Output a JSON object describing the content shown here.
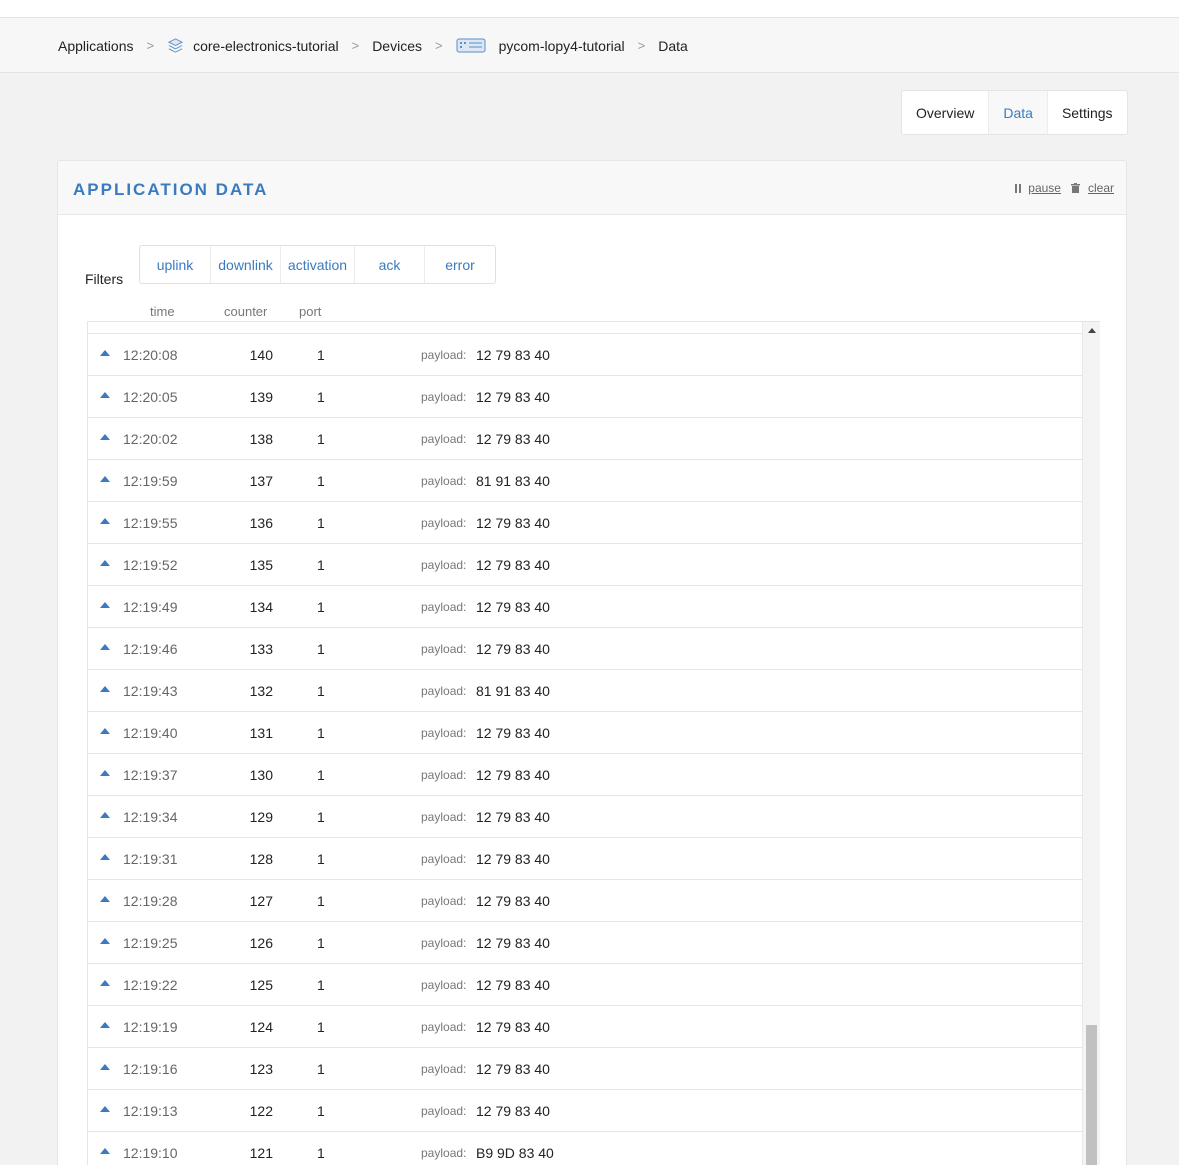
{
  "breadcrumb": {
    "applications": "Applications",
    "application": "core-electronics-tutorial",
    "devices": "Devices",
    "device": "pycom-lopy4-tutorial",
    "current": "Data",
    "separator": ">"
  },
  "tabs": [
    {
      "label": "Overview",
      "active": false
    },
    {
      "label": "Data",
      "active": true
    },
    {
      "label": "Settings",
      "active": false
    }
  ],
  "panel": {
    "title": "APPLICATION DATA",
    "pause_label": "pause",
    "clear_label": "clear"
  },
  "filters": {
    "label": "Filters",
    "items": [
      "uplink",
      "downlink",
      "activation",
      "ack",
      "error"
    ]
  },
  "columns": {
    "time": "time",
    "counter": "counter",
    "port": "port"
  },
  "payload_label": "payload:",
  "rows": [
    {
      "time": "12:20:08",
      "counter": "140",
      "port": "1",
      "payload": "12 79 83 40"
    },
    {
      "time": "12:20:05",
      "counter": "139",
      "port": "1",
      "payload": "12 79 83 40"
    },
    {
      "time": "12:20:02",
      "counter": "138",
      "port": "1",
      "payload": "12 79 83 40"
    },
    {
      "time": "12:19:59",
      "counter": "137",
      "port": "1",
      "payload": "81 91 83 40"
    },
    {
      "time": "12:19:55",
      "counter": "136",
      "port": "1",
      "payload": "12 79 83 40"
    },
    {
      "time": "12:19:52",
      "counter": "135",
      "port": "1",
      "payload": "12 79 83 40"
    },
    {
      "time": "12:19:49",
      "counter": "134",
      "port": "1",
      "payload": "12 79 83 40"
    },
    {
      "time": "12:19:46",
      "counter": "133",
      "port": "1",
      "payload": "12 79 83 40"
    },
    {
      "time": "12:19:43",
      "counter": "132",
      "port": "1",
      "payload": "81 91 83 40"
    },
    {
      "time": "12:19:40",
      "counter": "131",
      "port": "1",
      "payload": "12 79 83 40"
    },
    {
      "time": "12:19:37",
      "counter": "130",
      "port": "1",
      "payload": "12 79 83 40"
    },
    {
      "time": "12:19:34",
      "counter": "129",
      "port": "1",
      "payload": "12 79 83 40"
    },
    {
      "time": "12:19:31",
      "counter": "128",
      "port": "1",
      "payload": "12 79 83 40"
    },
    {
      "time": "12:19:28",
      "counter": "127",
      "port": "1",
      "payload": "12 79 83 40"
    },
    {
      "time": "12:19:25",
      "counter": "126",
      "port": "1",
      "payload": "12 79 83 40"
    },
    {
      "time": "12:19:22",
      "counter": "125",
      "port": "1",
      "payload": "12 79 83 40"
    },
    {
      "time": "12:19:19",
      "counter": "124",
      "port": "1",
      "payload": "12 79 83 40"
    },
    {
      "time": "12:19:16",
      "counter": "123",
      "port": "1",
      "payload": "12 79 83 40"
    },
    {
      "time": "12:19:13",
      "counter": "122",
      "port": "1",
      "payload": "12 79 83 40"
    },
    {
      "time": "12:19:10",
      "counter": "121",
      "port": "1",
      "payload": "B9 9D 83 40"
    }
  ],
  "colors": {
    "accent": "#3a7bbf",
    "background": "#f2f2f2"
  },
  "icons": {
    "application": "stack-icon",
    "device": "device-icon",
    "uplink": "uplink-arrow-icon",
    "pause": "pause-icon",
    "clear": "trash-icon"
  }
}
